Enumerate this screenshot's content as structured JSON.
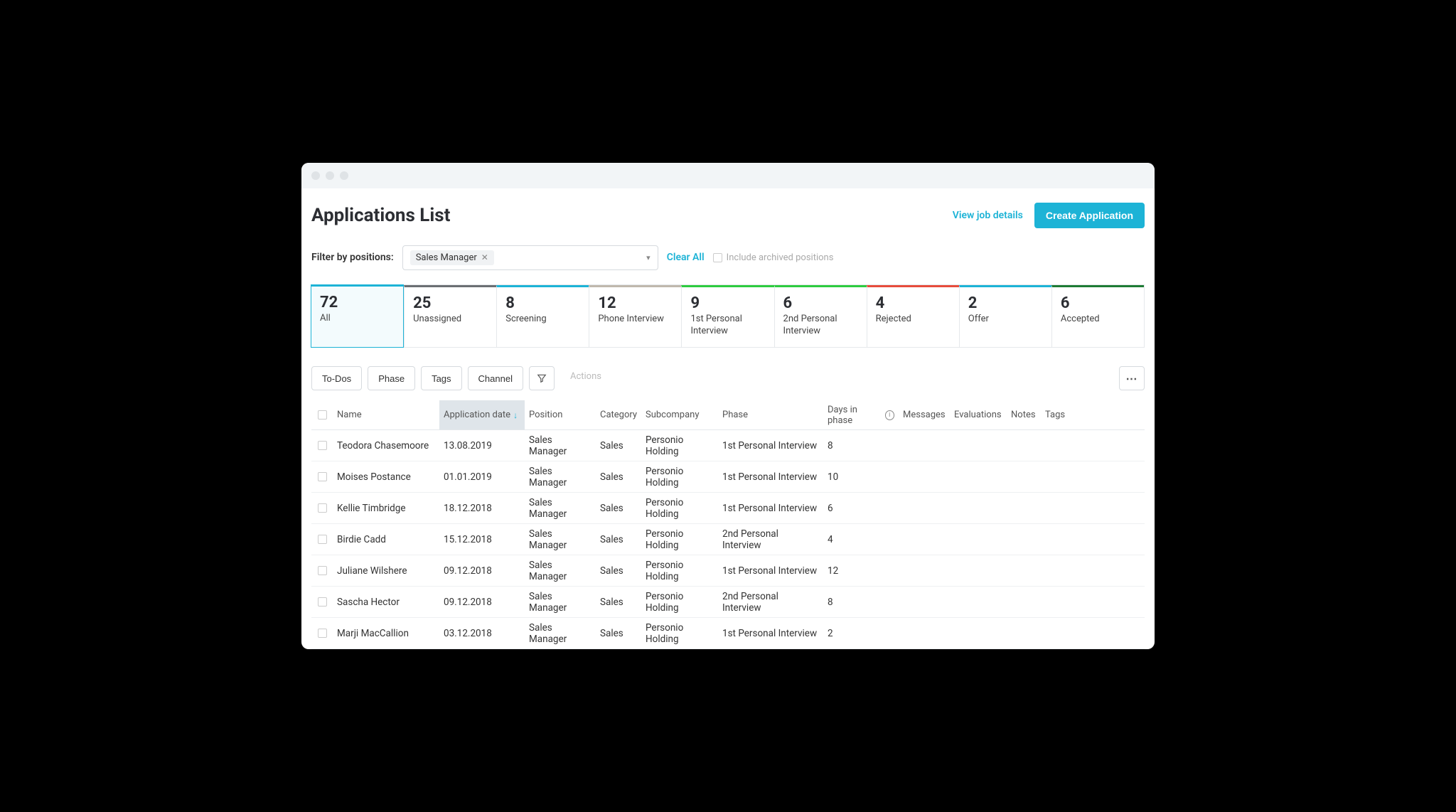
{
  "page": {
    "title": "Applications List",
    "viewJobDetails": "View job details",
    "createApplication": "Create Application"
  },
  "filter": {
    "label": "Filter by positions:",
    "chip": "Sales Manager",
    "clearAll": "Clear All",
    "archivedLabel": "Include archived positions"
  },
  "stages": [
    {
      "count": "72",
      "label": "All",
      "color": "#1db3d6",
      "active": true
    },
    {
      "count": "25",
      "label": "Unassigned",
      "color": "#6b6f73"
    },
    {
      "count": "8",
      "label": "Screening",
      "color": "#1db3d6"
    },
    {
      "count": "12",
      "label": "Phone Interview",
      "color": "#bfb8ad"
    },
    {
      "count": "9",
      "label": "1st Personal Interview",
      "color": "#2ecc40"
    },
    {
      "count": "6",
      "label": "2nd Personal Interview",
      "color": "#2ecc40"
    },
    {
      "count": "4",
      "label": "Rejected",
      "color": "#e74c3c"
    },
    {
      "count": "2",
      "label": "Offer",
      "color": "#1db3d6"
    },
    {
      "count": "6",
      "label": "Accepted",
      "color": "#1e7b34"
    }
  ],
  "toolbar": {
    "todos": "To-Dos",
    "phase": "Phase",
    "tags": "Tags",
    "channel": "Channel",
    "actions": "Actions"
  },
  "columns": {
    "name": "Name",
    "date": "Application date",
    "position": "Position",
    "category": "Category",
    "subcompany": "Subcompany",
    "phase": "Phase",
    "days": "Days in phase",
    "messages": "Messages",
    "evaluations": "Evaluations",
    "notes": "Notes",
    "tags": "Tags"
  },
  "rows": [
    {
      "name": "Teodora Chasemoore",
      "date": "13.08.2019",
      "position": "Sales Manager",
      "category": "Sales",
      "subcompany": "Personio Holding",
      "phase": "1st Personal Interview",
      "days": "8"
    },
    {
      "name": "Moises Postance",
      "date": "01.01.2019",
      "position": "Sales Manager",
      "category": "Sales",
      "subcompany": "Personio Holding",
      "phase": "1st Personal Interview",
      "days": "10"
    },
    {
      "name": "Kellie Timbridge",
      "date": "18.12.2018",
      "position": "Sales Manager",
      "category": "Sales",
      "subcompany": "Personio Holding",
      "phase": "1st Personal Interview",
      "days": "6"
    },
    {
      "name": "Birdie Cadd",
      "date": "15.12.2018",
      "position": "Sales Manager",
      "category": "Sales",
      "subcompany": "Personio Holding",
      "phase": "2nd Personal Interview",
      "days": "4"
    },
    {
      "name": "Juliane Wilshere",
      "date": "09.12.2018",
      "position": "Sales Manager",
      "category": "Sales",
      "subcompany": "Personio Holding",
      "phase": "1st Personal Interview",
      "days": "12"
    },
    {
      "name": "Sascha Hector",
      "date": "09.12.2018",
      "position": "Sales Manager",
      "category": "Sales",
      "subcompany": "Personio Holding",
      "phase": "2nd Personal Interview",
      "days": "8"
    },
    {
      "name": "Marji MacCallion",
      "date": "03.12.2018",
      "position": "Sales Manager",
      "category": "Sales",
      "subcompany": "Personio Holding",
      "phase": "1st Personal Interview",
      "days": "2"
    }
  ]
}
